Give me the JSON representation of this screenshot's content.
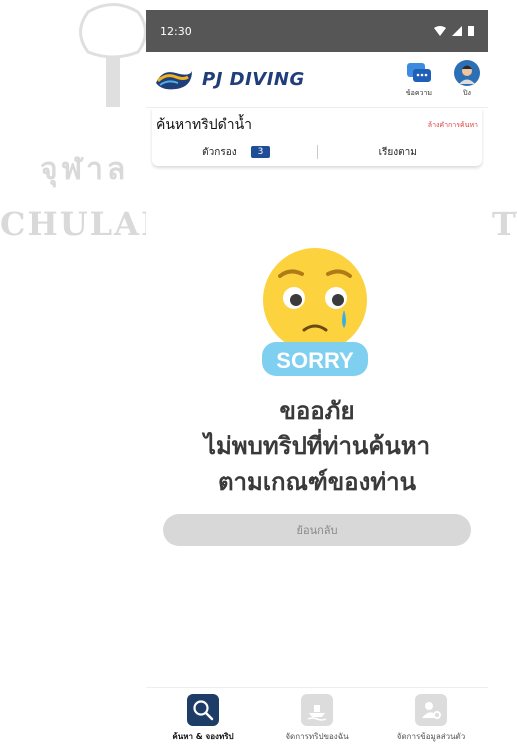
{
  "statusbar": {
    "time": "12:30"
  },
  "app": {
    "name": "PJ DIVING"
  },
  "header": {
    "messages_label": "ข้อความ",
    "profile_label": "ปิง"
  },
  "search": {
    "title": "ค้นหาทริปดำน้ำ",
    "clear_label": "ล้างคำการค้นหา",
    "filter_label": "ตัวกรอง",
    "filter_count": "3",
    "sort_label": "เรียงตาม"
  },
  "empty": {
    "sorry_text": "SORRY",
    "line1": "ขออภัย",
    "line2": "ไม่พบทริปที่ท่านค้นหา",
    "line3": "ตามเกณฑ์ของท่าน",
    "back_label": "ย้อนกลับ"
  },
  "nav": [
    {
      "label": "ค้นหา & จองทริป",
      "active": true
    },
    {
      "label": "จัดการทริปของฉัน",
      "active": false
    },
    {
      "label": "จัดการข้อมูลส่วนตัว",
      "active": false
    }
  ],
  "watermark": {
    "thai": "จุฬาล",
    "eng_left": "CHULAL",
    "eng_right": "TY"
  },
  "colors": {
    "primary": "#1f4e96",
    "statusbar": "#565656",
    "clear": "#e04040",
    "button": "#d8d8d8"
  }
}
